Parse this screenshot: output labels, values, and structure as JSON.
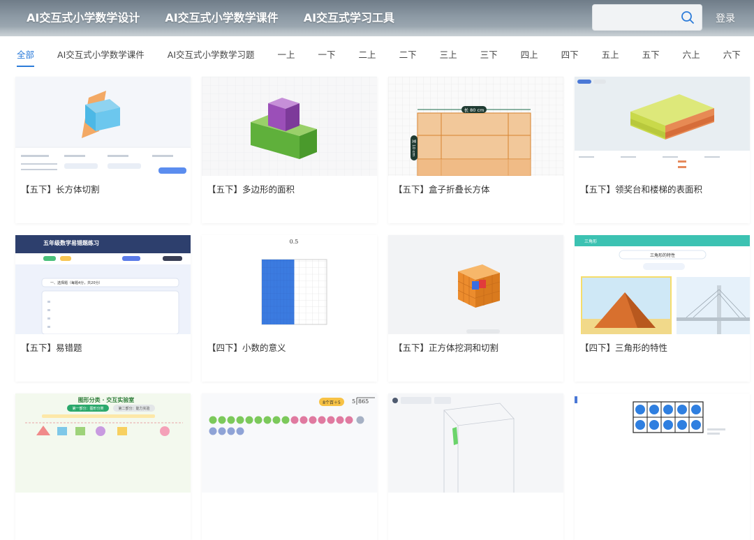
{
  "header": {
    "nav": [
      {
        "label": "AI交互式小学数学设计"
      },
      {
        "label": "AI交互式小学数学课件"
      },
      {
        "label": "AI交互式学习工具"
      }
    ],
    "search": {
      "value": "",
      "placeholder": ""
    },
    "login_label": "登录"
  },
  "tabs": [
    {
      "label": "全部",
      "active": true
    },
    {
      "label": "AI交互式小学数学课件"
    },
    {
      "label": "AI交互式小学数学习题"
    },
    {
      "label": "一上"
    },
    {
      "label": "一下"
    },
    {
      "label": "二上"
    },
    {
      "label": "二下"
    },
    {
      "label": "三上"
    },
    {
      "label": "三下"
    },
    {
      "label": "四上"
    },
    {
      "label": "四下"
    },
    {
      "label": "五上"
    },
    {
      "label": "五下"
    },
    {
      "label": "六上"
    },
    {
      "label": "六下"
    }
  ],
  "cards": [
    {
      "title": "【五下】长方体切割"
    },
    {
      "title": "【五下】多边形的面积"
    },
    {
      "title": "【五下】盒子折叠长方体",
      "thumb_text": {
        "top": "长 80 cm",
        "side": "宽 10 cm"
      }
    },
    {
      "title": "【五下】领奖台和楼梯的表面积"
    },
    {
      "title": "【五下】易错题",
      "thumb_text": {
        "heading": "五年级数学易错题练习",
        "section": "一、选择题（每题4分，共20分）"
      }
    },
    {
      "title": "【四下】小数的意义",
      "thumb_text": {
        "value": "0.5"
      }
    },
    {
      "title": "【五下】正方体挖洞和切割"
    },
    {
      "title": "【四下】三角形的特性",
      "thumb_text": {
        "tag": "三角形",
        "heading": "三角形的特性"
      }
    },
    {
      "title": "",
      "thumb_text": {
        "heading": "图形分类 · 交互实验室",
        "btn1": "第一部分：图形分类",
        "btn2": "第二部分：能力实验"
      }
    },
    {
      "title": "",
      "thumb_text": {
        "badge": "8个百＋5",
        "dividend": "865",
        "divisor": "5"
      }
    },
    {
      "title": ""
    },
    {
      "title": ""
    }
  ],
  "colors": {
    "accent": "#2b7bd9",
    "header_bg": "#8c99a4"
  }
}
